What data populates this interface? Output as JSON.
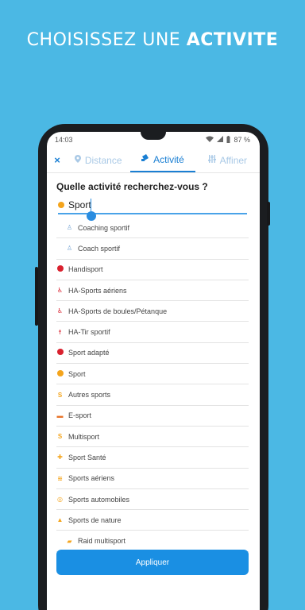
{
  "headline": {
    "normal": "CHOISISSEZ UNE ",
    "bold": "ACTIVITE"
  },
  "status": {
    "time": "14:03",
    "battery": "87 %"
  },
  "tabs": {
    "close": "×",
    "items": [
      {
        "label": "Distance",
        "icon": "map-pin-icon",
        "active": false
      },
      {
        "label": "Activité",
        "icon": "ticket-icon",
        "active": true
      },
      {
        "label": "Affiner",
        "icon": "sliders-icon",
        "active": false
      }
    ]
  },
  "question": "Quelle activité recherchez-vous ?",
  "search": {
    "value": "Sport"
  },
  "list": [
    {
      "label": "Coaching sportif",
      "icon": "person-icon",
      "color": "#7aa7d6",
      "sub": true
    },
    {
      "label": "Coach sportif",
      "icon": "person-icon",
      "color": "#7aa7d6",
      "sub": true
    },
    {
      "label": "Handisport",
      "icon": "dot-icon",
      "color": "#d9212e",
      "sub": false
    },
    {
      "label": "HA-Sports aériens",
      "icon": "wheelchair-icon",
      "color": "#d9212e",
      "sub": false
    },
    {
      "label": "HA-Sports de boules/Pétanque",
      "icon": "wheelchair-icon",
      "color": "#d9212e",
      "sub": false
    },
    {
      "label": "HA-Tir sportif",
      "icon": "shooter-icon",
      "color": "#d9212e",
      "sub": false
    },
    {
      "label": "Sport adapté",
      "icon": "dot-icon",
      "color": "#d9212e",
      "sub": false
    },
    {
      "label": "Sport",
      "icon": "dot-icon",
      "color": "#f4a41c",
      "sub": false
    },
    {
      "label": "Autres sports",
      "icon": "s-icon",
      "color": "#f4a41c",
      "sub": false
    },
    {
      "label": "E-sport",
      "icon": "gamepad-icon",
      "color": "#e8742a",
      "sub": false
    },
    {
      "label": "Multisport",
      "icon": "s-icon",
      "color": "#f4a41c",
      "sub": false
    },
    {
      "label": "Sport Santé",
      "icon": "health-icon",
      "color": "#f4a41c",
      "sub": false
    },
    {
      "label": "Sports aériens",
      "icon": "wings-icon",
      "color": "#f4a41c",
      "sub": false
    },
    {
      "label": "Sports automobiles",
      "icon": "steering-icon",
      "color": "#f4a41c",
      "sub": false
    },
    {
      "label": "Sports de nature",
      "icon": "mountain-icon",
      "color": "#f4a41c",
      "sub": false
    },
    {
      "label": "Raid multisport",
      "icon": "shoe-icon",
      "color": "#f4a41c",
      "sub": true
    }
  ],
  "apply": "Appliquer",
  "colors": {
    "background": "#4bb8e4",
    "accent": "#1a8fe3",
    "sport": "#f4a41c",
    "handisport": "#d9212e"
  }
}
